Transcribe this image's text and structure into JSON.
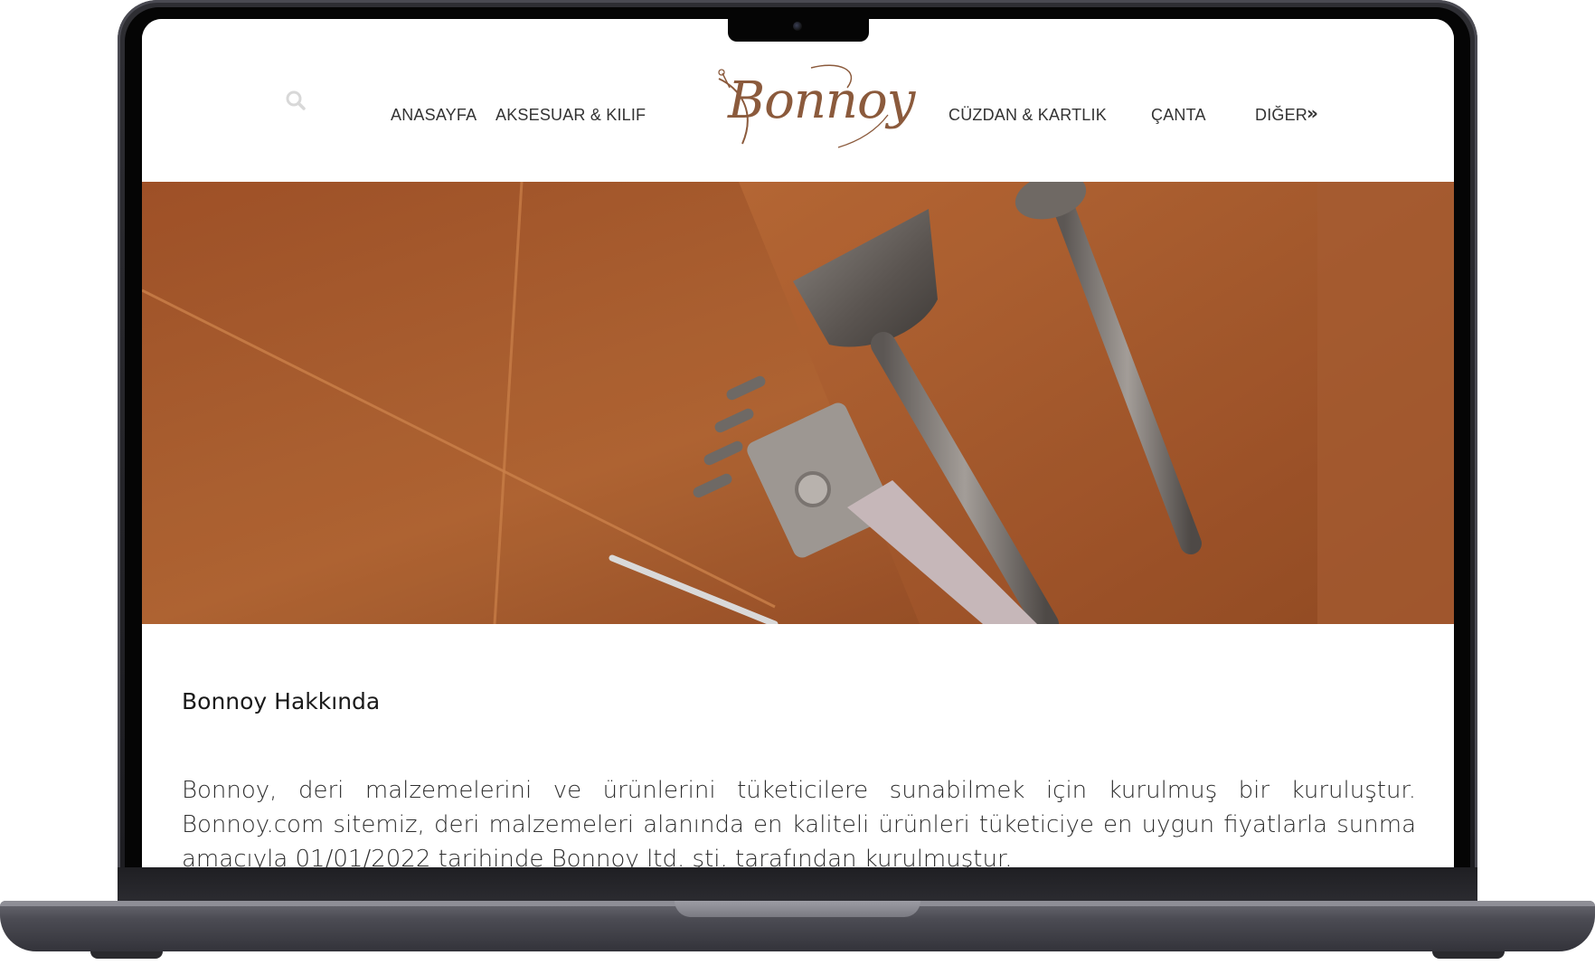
{
  "header": {
    "nav_left": [
      {
        "label": "ANASAYFA"
      },
      {
        "label": "AKSESUAR & KILIF"
      }
    ],
    "nav_right": [
      {
        "label": "CÜZDAN & KARTLIK"
      },
      {
        "label": "ÇANTA"
      },
      {
        "label": "DIĞER"
      }
    ],
    "more_arrow": "»",
    "logo_text": "Bonnoy",
    "icons": {
      "search": "search-icon"
    }
  },
  "main": {
    "about_title": "Bonnoy Hakkında",
    "about_body": "Bonnoy, deri malzemelerini ve ürünlerini tüketicilere sunabilmek için kurulmuş bir kuruluştur. Bonnoy.com sitemiz, deri malzemeleri alanında en kaliteli ürünleri tüketiciye en uygun fiyatlarla sunma amacıyla 01/01/2022 tarihinde Bonnoy ltd. şti. tarafından kurulmuştur."
  },
  "colors": {
    "brand": "#8b5a3c",
    "leather": "#b8652e",
    "text": "#333333"
  }
}
